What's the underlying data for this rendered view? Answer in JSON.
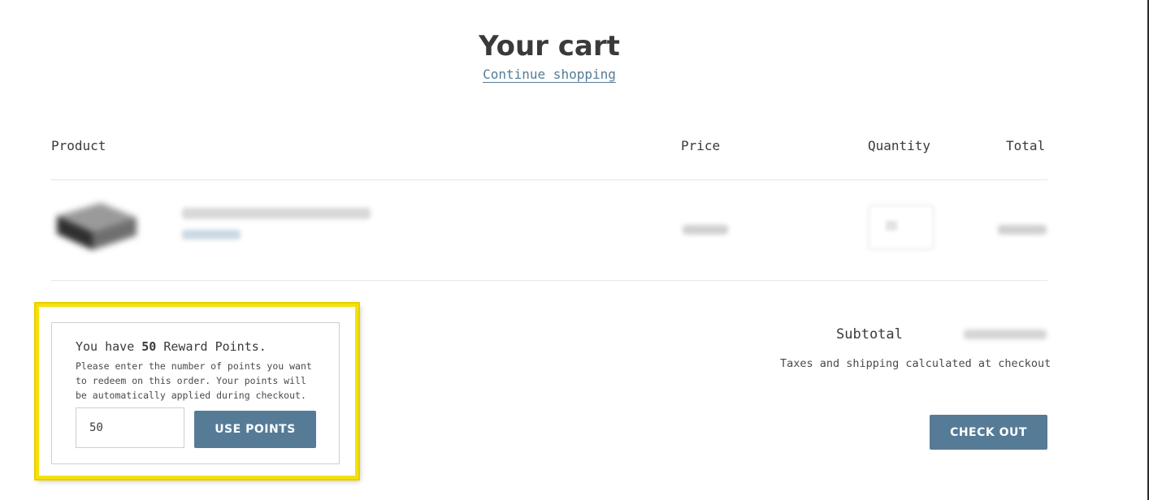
{
  "page": {
    "title": "Your cart",
    "continue_shopping_label": "Continue shopping"
  },
  "table": {
    "headers": {
      "product": "Product",
      "price": "Price",
      "quantity": "Quantity",
      "total": "Total"
    }
  },
  "rewards": {
    "prefix": "You have ",
    "points": "50",
    "suffix": " Reward Points.",
    "help_text": "Please enter the number of points you want to redeem on this order. Your points will be automatically applied during checkout.",
    "input_value": "50",
    "button_label": "USE POINTS",
    "highlight_color": "#f4e10a"
  },
  "summary": {
    "subtotal_label": "Subtotal",
    "taxes_note": "Taxes and shipping calculated at checkout",
    "checkout_label": "CHECK OUT"
  },
  "colors": {
    "accent": "#557b97",
    "text": "#3a3a3a"
  }
}
